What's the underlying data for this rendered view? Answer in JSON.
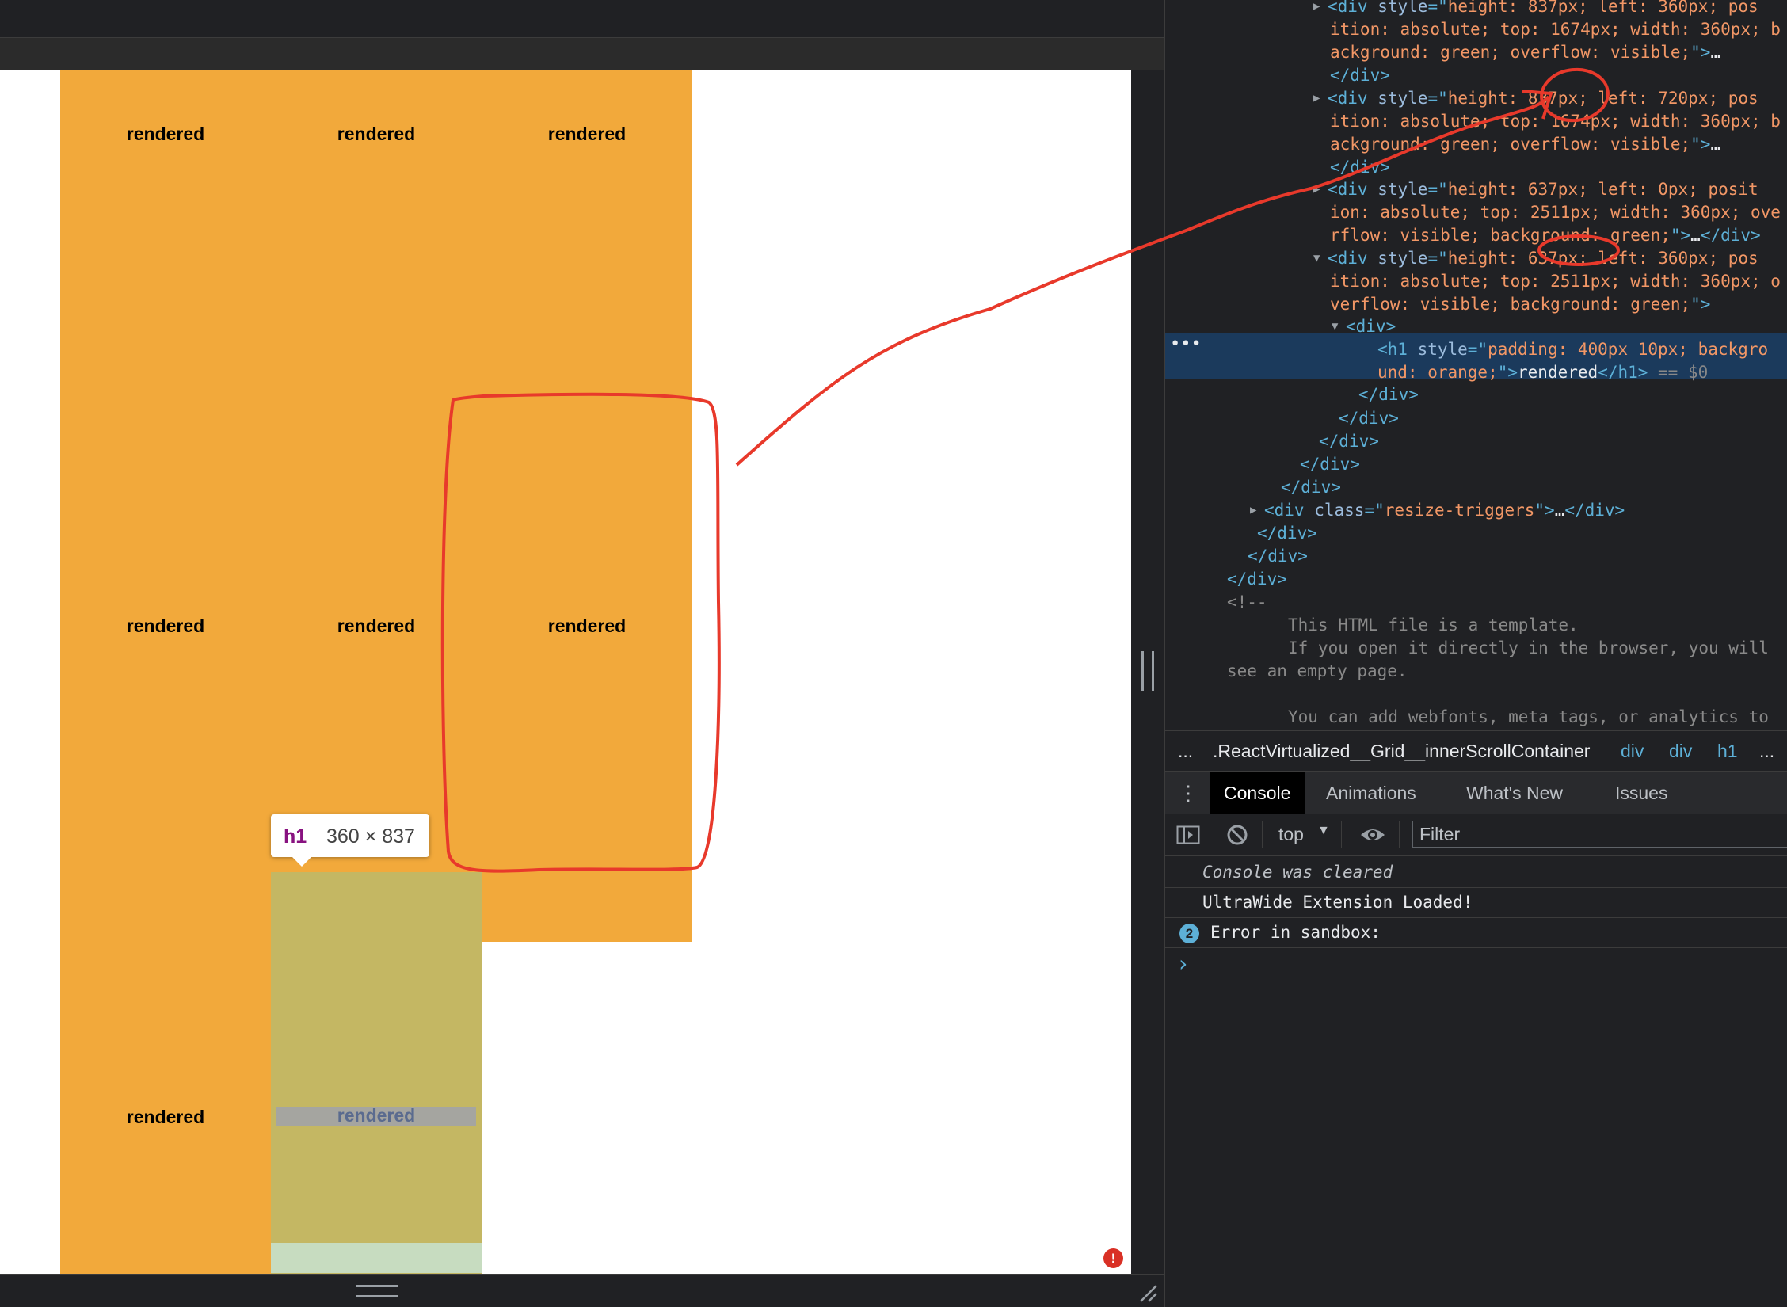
{
  "grid": {
    "cell_label": "rendered",
    "rows": [
      [
        "rendered",
        "rendered",
        "rendered"
      ],
      [
        "rendered",
        "rendered",
        "rendered"
      ],
      [
        "rendered",
        "rendered"
      ]
    ],
    "highlight_label": "rendered"
  },
  "tooltip": {
    "tag": "h1",
    "size": "360 × 837"
  },
  "colors": {
    "cell": "#f2a93b",
    "highlight": "#c4b763",
    "annotation": "#e8392b",
    "selected_row": "#1b3a5c",
    "tag": "#5db0d7",
    "attr_value": "#f29766"
  },
  "dom": {
    "lines": [
      {
        "tri": "▶",
        "parts": [
          [
            "tg",
            "<div "
          ],
          [
            "an",
            "style"
          ],
          [
            "tg",
            "=\""
          ],
          [
            "av",
            "height: 837px; left: 360px; pos"
          ]
        ]
      },
      {
        "parts": [
          [
            "av",
            "ition: absolute; top: 1674px; width: 360px; b"
          ]
        ]
      },
      {
        "parts": [
          [
            "av",
            "ackground: green; overflow: visible;"
          ],
          [
            "tg",
            "\">"
          ],
          [
            "tx",
            "…"
          ]
        ]
      },
      {
        "parts": [
          [
            "tg",
            "</div>"
          ]
        ]
      },
      {
        "tri": "▶",
        "parts": [
          [
            "tg",
            "<div "
          ],
          [
            "an",
            "style"
          ],
          [
            "tg",
            "=\""
          ],
          [
            "av",
            "height: 837px; left: 720px; pos"
          ]
        ]
      },
      {
        "parts": [
          [
            "av",
            "ition: absolute; top: 1674px; width: 360px; b"
          ]
        ]
      },
      {
        "parts": [
          [
            "av",
            "ackground: green; overflow: visible;"
          ],
          [
            "tg",
            "\">"
          ],
          [
            "tx",
            "…"
          ]
        ]
      },
      {
        "parts": [
          [
            "tg",
            "</div>"
          ]
        ]
      },
      {
        "tri": "▶",
        "parts": [
          [
            "tg",
            "<div "
          ],
          [
            "an",
            "style"
          ],
          [
            "tg",
            "=\""
          ],
          [
            "av",
            "height: 637px; left: 0px; posit"
          ]
        ]
      },
      {
        "parts": [
          [
            "av",
            "ion: absolute; top: 2511px; width: 360px; ove"
          ]
        ]
      },
      {
        "parts": [
          [
            "av",
            "rflow: visible; background: green;"
          ],
          [
            "tg",
            "\">"
          ],
          [
            "tx",
            "…"
          ],
          [
            "tg",
            "</div>"
          ]
        ]
      },
      {
        "tri": "▼",
        "parts": [
          [
            "tg",
            "<div "
          ],
          [
            "an",
            "style"
          ],
          [
            "tg",
            "=\""
          ],
          [
            "av",
            "height: 637px; left: 360px; pos"
          ]
        ]
      },
      {
        "parts": [
          [
            "av",
            "ition: absolute; top: 2511px; width: 360px; o"
          ]
        ]
      },
      {
        "parts": [
          [
            "av",
            "verflow: visible; background: green;"
          ],
          [
            "tg",
            "\">"
          ]
        ]
      },
      {
        "tri": "▼",
        "parts": [
          [
            "tg",
            "<div>"
          ]
        ]
      },
      {
        "parts": [
          [
            "tg",
            "<h1 "
          ],
          [
            "an",
            "style"
          ],
          [
            "tg",
            "=\""
          ],
          [
            "av",
            "padding: 400px 10px; backgro"
          ]
        ]
      },
      {
        "parts": [
          [
            "av",
            "und: orange;"
          ],
          [
            "tg",
            "\">"
          ],
          [
            "tx",
            "rendered"
          ],
          [
            "tg",
            "</h1>"
          ],
          [
            "cm",
            " == $0"
          ]
        ]
      },
      {
        "parts": [
          [
            "tg",
            "</div>"
          ]
        ]
      },
      {
        "parts": [
          [
            "tg",
            "</div>"
          ]
        ]
      },
      {
        "parts": [
          [
            "tg",
            "</div>"
          ]
        ]
      },
      {
        "parts": [
          [
            "tg",
            "</div>"
          ]
        ]
      },
      {
        "parts": [
          [
            "tg",
            "</div>"
          ]
        ]
      },
      {
        "tri": "▶",
        "parts": [
          [
            "tg",
            "<div "
          ],
          [
            "an",
            "class"
          ],
          [
            "tg",
            "=\""
          ],
          [
            "av",
            "resize-triggers"
          ],
          [
            "tg",
            "\">"
          ],
          [
            "tx",
            "…"
          ],
          [
            "tg",
            "</div>"
          ]
        ]
      },
      {
        "parts": [
          [
            "tg",
            "</div>"
          ]
        ]
      },
      {
        "parts": [
          [
            "tg",
            "</div>"
          ]
        ]
      },
      {
        "parts": [
          [
            "tg",
            "</div>"
          ]
        ]
      },
      {
        "parts": [
          [
            "cm",
            "<!--"
          ]
        ]
      },
      {
        "parts": [
          [
            "cm",
            "This HTML file is a template."
          ]
        ]
      },
      {
        "parts": [
          [
            "cm",
            "If you open it directly in the browser, you will"
          ]
        ]
      },
      {
        "parts": [
          [
            "cm",
            "see an empty page."
          ]
        ]
      },
      {
        "parts": [
          [
            "cm",
            ""
          ]
        ]
      },
      {
        "parts": [
          [
            "cm",
            "You can add webfonts, meta tags, or analytics to"
          ]
        ]
      }
    ]
  },
  "breadcrumbs": {
    "more": "...",
    "items": [
      ".ReactVirtualized__Grid__innerScrollContainer",
      "div",
      "div",
      "h1"
    ],
    "overflow": "..."
  },
  "drawer_tabs": {
    "menu": "⋮",
    "items": [
      "Console",
      "Animations",
      "What's New",
      "Issues"
    ]
  },
  "console_toolbar": {
    "context": "top",
    "filter_placeholder": "Filter"
  },
  "console": {
    "cleared": "Console was cleared",
    "message": "UltraWide Extension Loaded!",
    "error_count": "2",
    "error": "Error in sandbox:",
    "prompt": "›"
  },
  "icons": {
    "error_indicator": "error-circle-icon",
    "sidebar_toggle": "sidebar-toggle-icon",
    "clear": "clear-console-icon",
    "eye": "eye-icon",
    "dropdown": "chevron-down-icon"
  }
}
